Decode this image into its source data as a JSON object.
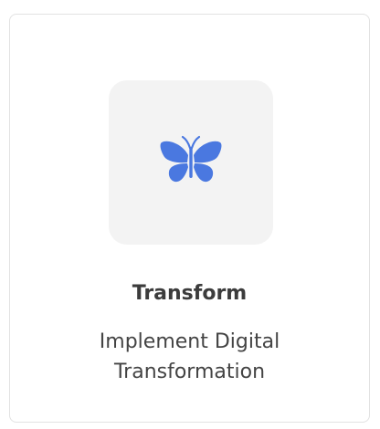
{
  "card": {
    "icon": "butterfly-icon",
    "icon_color": "#4a78e0",
    "title": "Transform",
    "description": "Implement Digital Transformation"
  }
}
